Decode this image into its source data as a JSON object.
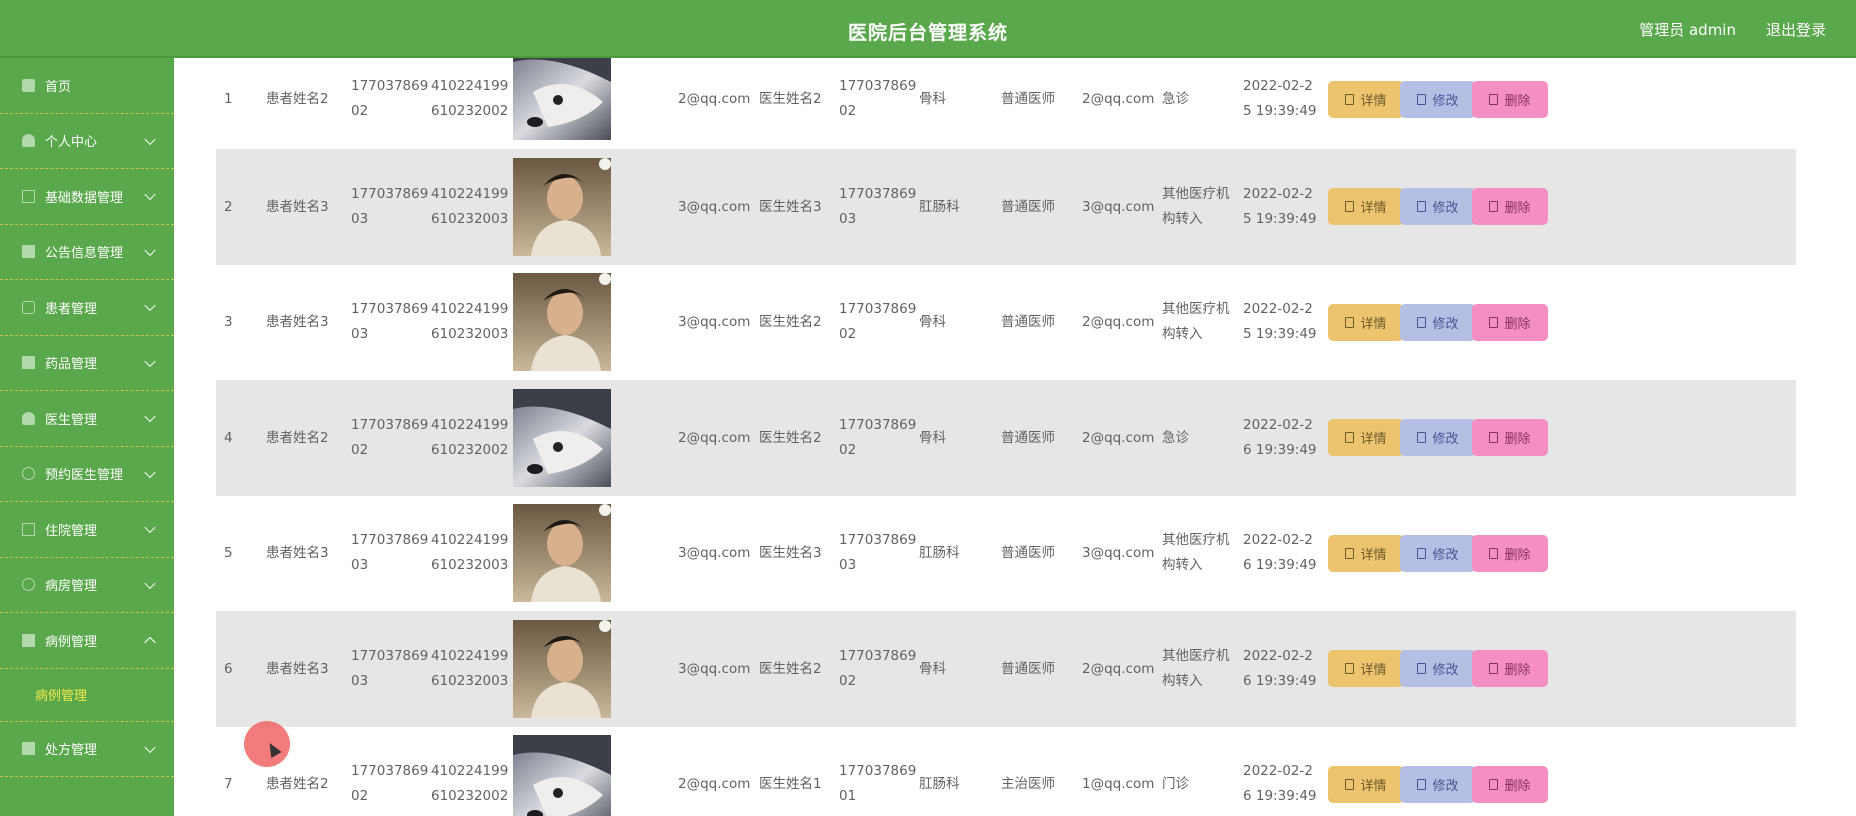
{
  "header": {
    "title": "医院后台管理系统",
    "user": "管理员 admin",
    "logout": "退出登录"
  },
  "sidebar": {
    "items": [
      {
        "label": "首页",
        "icon": "home-icon"
      },
      {
        "label": "个人中心",
        "icon": "user-icon"
      },
      {
        "label": "基础数据管理",
        "icon": "data-icon"
      },
      {
        "label": "公告信息管理",
        "icon": "notice-icon"
      },
      {
        "label": "患者管理",
        "icon": "patient-icon"
      },
      {
        "label": "药品管理",
        "icon": "medicine-icon"
      },
      {
        "label": "医生管理",
        "icon": "doctor-icon"
      },
      {
        "label": "预约医生管理",
        "icon": "appointment-icon"
      },
      {
        "label": "住院管理",
        "icon": "hospital-icon"
      },
      {
        "label": "病房管理",
        "icon": "ward-icon"
      },
      {
        "label": "病例管理",
        "icon": "case-icon"
      },
      {
        "label": "处方管理",
        "icon": "prescription-icon"
      }
    ],
    "submenu": "病例管理"
  },
  "rows": [
    {
      "index": "1",
      "patient": "患者姓名2",
      "phone_a": "177037869",
      "phone_b": "02",
      "id_a": "410224199",
      "id_b": "610232002",
      "photo": "husky",
      "email": "2@qq.com",
      "doctor": "医生姓名2",
      "dphone_a": "177037869",
      "dphone_b": "02",
      "dept": "骨科",
      "title": "普通医师",
      "demail": "2@qq.com",
      "type_a": "急诊",
      "type_b": "",
      "date_a": "2022-02-2",
      "date_b": "5 19:39:49"
    },
    {
      "index": "2",
      "patient": "患者姓名3",
      "phone_a": "177037869",
      "phone_b": "03",
      "id_a": "410224199",
      "id_b": "610232003",
      "photo": "man",
      "email": "3@qq.com",
      "doctor": "医生姓名3",
      "dphone_a": "177037869",
      "dphone_b": "03",
      "dept": "肛肠科",
      "title": "普通医师",
      "demail": "3@qq.com",
      "type_a": "其他医疗机",
      "type_b": "构转入",
      "date_a": "2022-02-2",
      "date_b": "5 19:39:49"
    },
    {
      "index": "3",
      "patient": "患者姓名3",
      "phone_a": "177037869",
      "phone_b": "03",
      "id_a": "410224199",
      "id_b": "610232003",
      "photo": "man",
      "email": "3@qq.com",
      "doctor": "医生姓名2",
      "dphone_a": "177037869",
      "dphone_b": "02",
      "dept": "骨科",
      "title": "普通医师",
      "demail": "2@qq.com",
      "type_a": "其他医疗机",
      "type_b": "构转入",
      "date_a": "2022-02-2",
      "date_b": "5 19:39:49"
    },
    {
      "index": "4",
      "patient": "患者姓名2",
      "phone_a": "177037869",
      "phone_b": "02",
      "id_a": "410224199",
      "id_b": "610232002",
      "photo": "husky",
      "email": "2@qq.com",
      "doctor": "医生姓名2",
      "dphone_a": "177037869",
      "dphone_b": "02",
      "dept": "骨科",
      "title": "普通医师",
      "demail": "2@qq.com",
      "type_a": "急诊",
      "type_b": "",
      "date_a": "2022-02-2",
      "date_b": "6 19:39:49"
    },
    {
      "index": "5",
      "patient": "患者姓名3",
      "phone_a": "177037869",
      "phone_b": "03",
      "id_a": "410224199",
      "id_b": "610232003",
      "photo": "man",
      "email": "3@qq.com",
      "doctor": "医生姓名3",
      "dphone_a": "177037869",
      "dphone_b": "03",
      "dept": "肛肠科",
      "title": "普通医师",
      "demail": "3@qq.com",
      "type_a": "其他医疗机",
      "type_b": "构转入",
      "date_a": "2022-02-2",
      "date_b": "6 19:39:49"
    },
    {
      "index": "6",
      "patient": "患者姓名3",
      "phone_a": "177037869",
      "phone_b": "03",
      "id_a": "410224199",
      "id_b": "610232003",
      "photo": "man",
      "email": "3@qq.com",
      "doctor": "医生姓名2",
      "dphone_a": "177037869",
      "dphone_b": "02",
      "dept": "骨科",
      "title": "普通医师",
      "demail": "2@qq.com",
      "type_a": "其他医疗机",
      "type_b": "构转入",
      "date_a": "2022-02-2",
      "date_b": "6 19:39:49"
    },
    {
      "index": "7",
      "patient": "患者姓名2",
      "phone_a": "177037869",
      "phone_b": "02",
      "id_a": "410224199",
      "id_b": "610232002",
      "photo": "husky",
      "email": "2@qq.com",
      "doctor": "医生姓名1",
      "dphone_a": "177037869",
      "dphone_b": "01",
      "dept": "肛肠科",
      "title": "主治医师",
      "demail": "1@qq.com",
      "type_a": "门诊",
      "type_b": "",
      "date_a": "2022-02-2",
      "date_b": "6 19:39:49"
    }
  ],
  "actions": {
    "detail": "详情",
    "edit": "修改",
    "delete": "删除"
  },
  "colors": {
    "primary": "#5aa84c",
    "accent_text": "#f2e84a",
    "detail": "#ecc46e",
    "edit": "#b5bfe6",
    "delete": "#f48ec3"
  }
}
